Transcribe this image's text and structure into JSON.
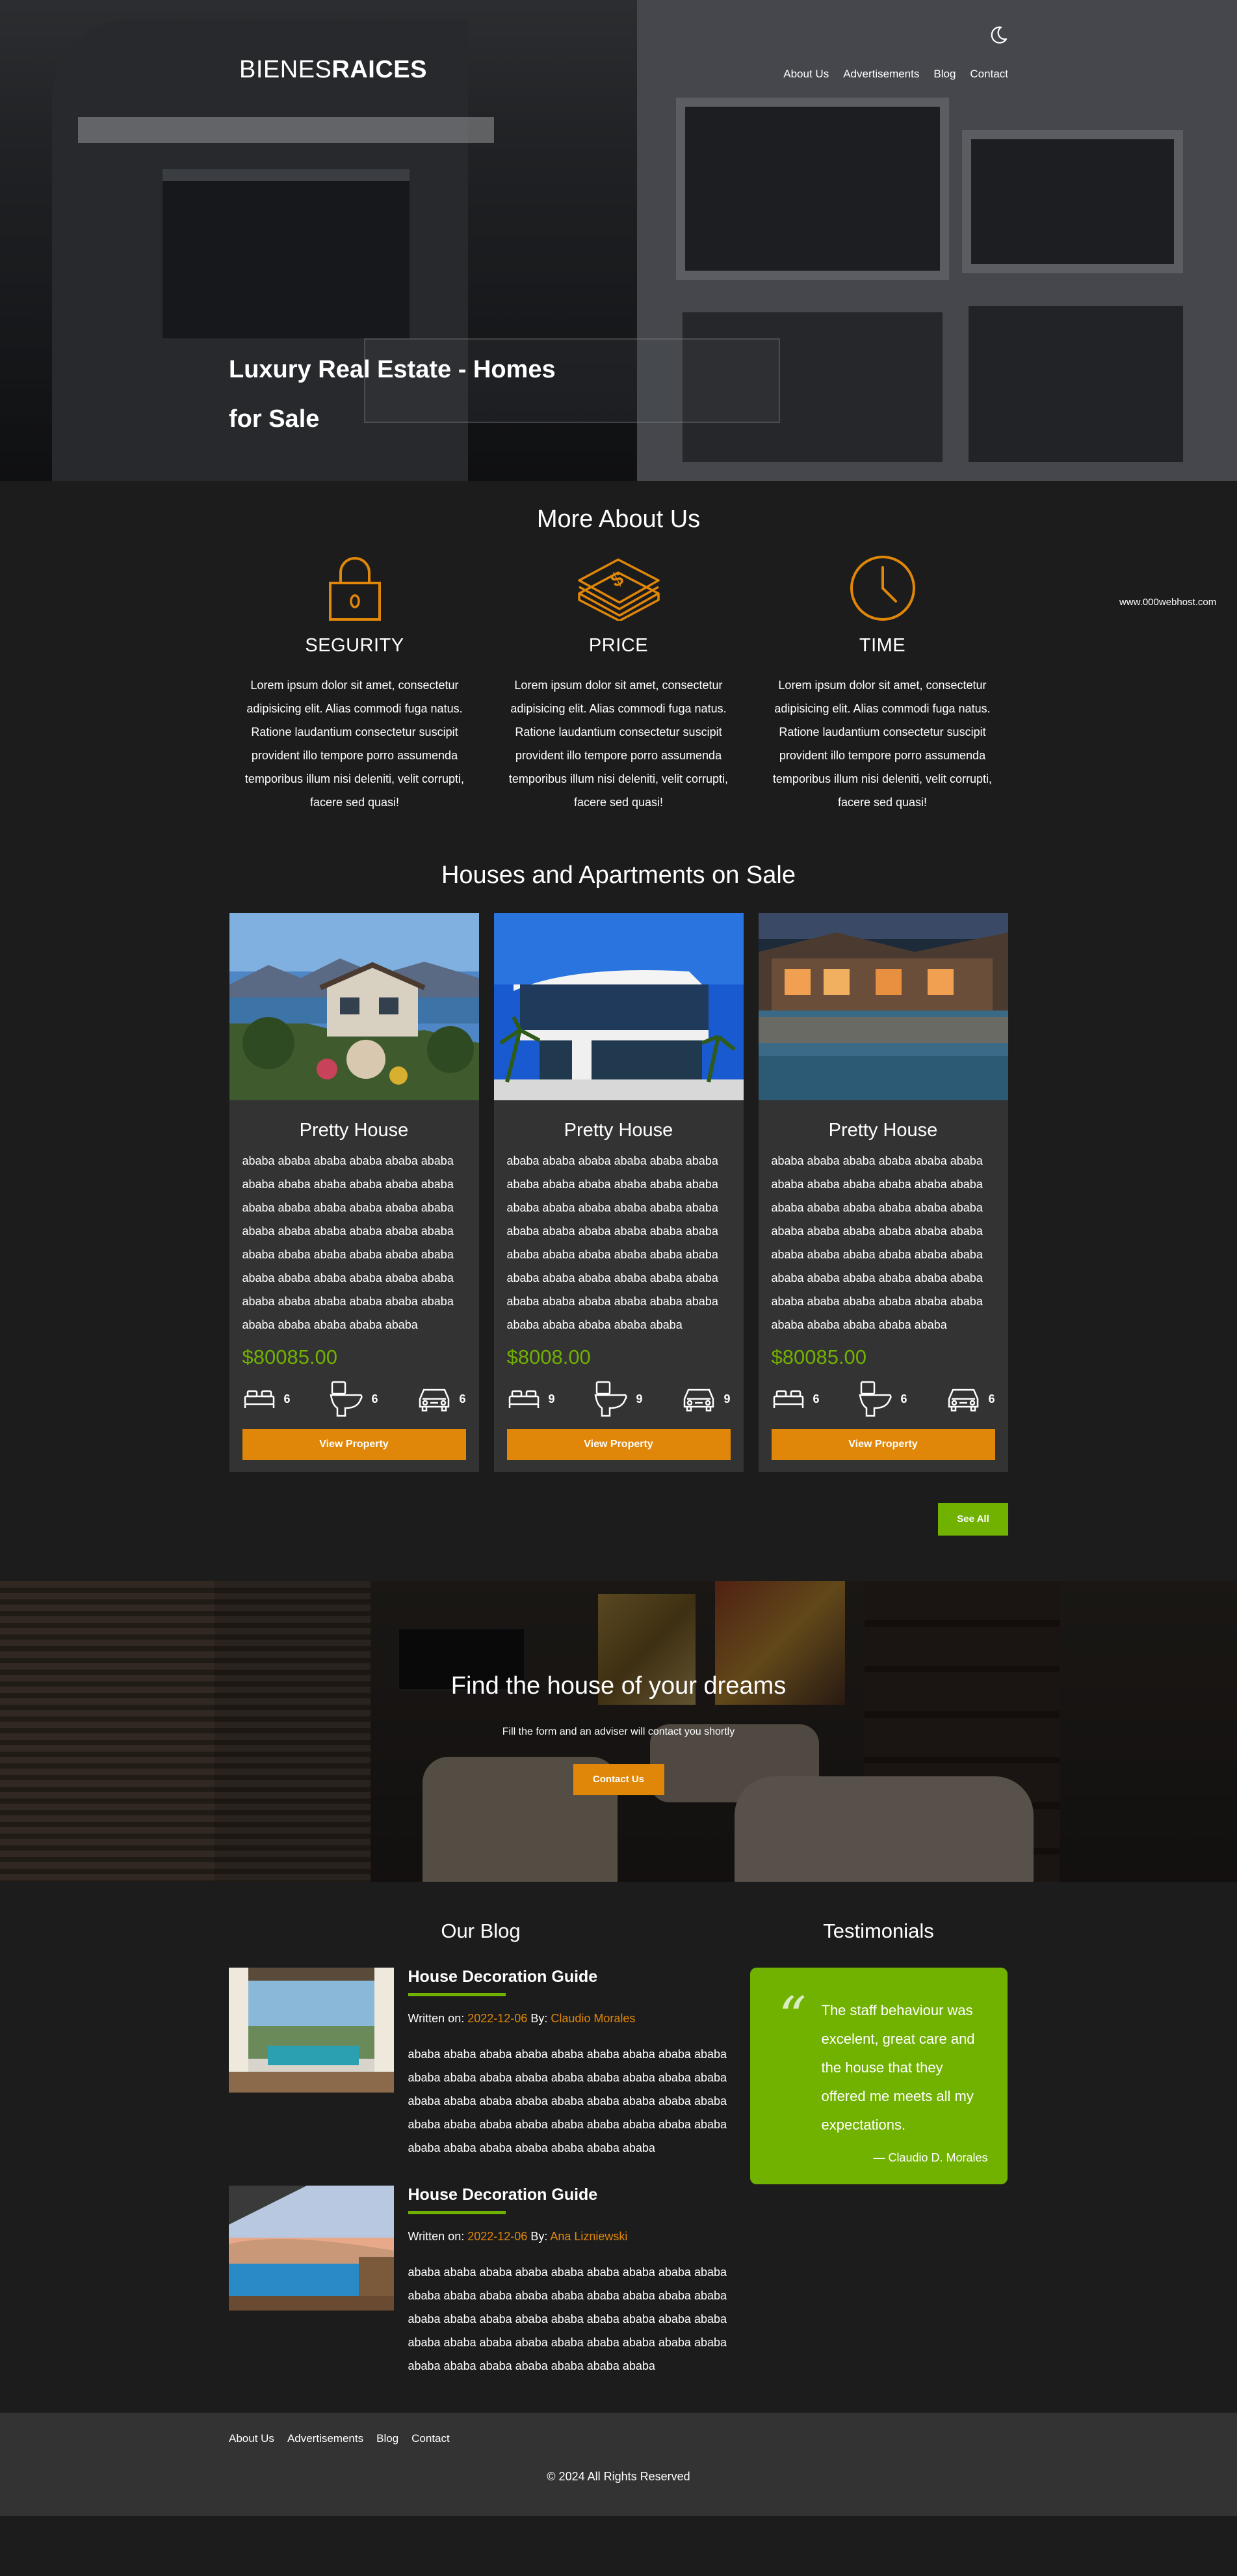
{
  "header": {
    "logo_light": "BIENES",
    "logo_bold": "RAICES",
    "nav": [
      "About Us",
      "Advertisements",
      "Blog",
      "Contact"
    ],
    "hero_title": "Luxury Real Estate - Homes for Sale"
  },
  "watermark": "www.000webhost.com",
  "about": {
    "title": "More About Us",
    "features": [
      {
        "icon": "lock-icon",
        "title": "SEGURITY",
        "text": "Lorem ipsum dolor sit amet, consectetur adipisicing elit. Alias commodi fuga natus. Ratione laudantium consectetur suscipit provident illo tempore porro assumenda temporibus illum nisi deleniti, velit corrupti, facere sed quasi!"
      },
      {
        "icon": "money-stack-icon",
        "title": "PRICE",
        "text": "Lorem ipsum dolor sit amet, consectetur adipisicing elit. Alias commodi fuga natus. Ratione laudantium consectetur suscipit provident illo tempore porro assumenda temporibus illum nisi deleniti, velit corrupti, facere sed quasi!"
      },
      {
        "icon": "clock-icon",
        "title": "TIME",
        "text": "Lorem ipsum dolor sit amet, consectetur adipisicing elit. Alias commodi fuga natus. Ratione laudantium consectetur suscipit provident illo tempore porro assumenda temporibus illum nisi deleniti, velit corrupti, facere sed quasi!"
      }
    ]
  },
  "listings": {
    "title": "Houses and Apartments on Sale",
    "cards": [
      {
        "title": "Pretty House",
        "desc": "ababa ababa ababa ababa ababa ababa ababa ababa ababa ababa ababa ababa ababa ababa ababa ababa ababa ababa ababa ababa ababa ababa ababa ababa ababa ababa ababa ababa ababa ababa ababa ababa ababa ababa ababa ababa ababa ababa ababa ababa ababa ababa ababa ababa ababa ababa ababa",
        "price": "$80085.00",
        "beds": "6",
        "baths": "6",
        "parking": "6",
        "button": "View Property"
      },
      {
        "title": "Pretty House",
        "desc": "ababa ababa ababa ababa ababa ababa ababa ababa ababa ababa ababa ababa ababa ababa ababa ababa ababa ababa ababa ababa ababa ababa ababa ababa ababa ababa ababa ababa ababa ababa ababa ababa ababa ababa ababa ababa ababa ababa ababa ababa ababa ababa ababa ababa ababa ababa ababa",
        "price": "$8008.00",
        "beds": "9",
        "baths": "9",
        "parking": "9",
        "button": "View Property"
      },
      {
        "title": "Pretty House",
        "desc": "ababa ababa ababa ababa ababa ababa ababa ababa ababa ababa ababa ababa ababa ababa ababa ababa ababa ababa ababa ababa ababa ababa ababa ababa ababa ababa ababa ababa ababa ababa ababa ababa ababa ababa ababa ababa ababa ababa ababa ababa ababa ababa ababa ababa ababa ababa ababa",
        "price": "$80085.00",
        "beds": "6",
        "baths": "6",
        "parking": "6",
        "button": "View Property"
      }
    ],
    "see_all": "See All"
  },
  "cta": {
    "title": "Find the house of your dreams",
    "text": "Fill the form and an adviser will contact you shortly",
    "button": "Contact Us"
  },
  "blog": {
    "title": "Our Blog",
    "posts": [
      {
        "title": "House Decoration Guide",
        "written_label": "Written on:",
        "date": "2022-12-06",
        "by_label": "By:",
        "author": "Claudio Morales",
        "text": "ababa ababa ababa ababa ababa ababa ababa ababa ababa ababa ababa ababa ababa ababa ababa ababa ababa ababa ababa ababa ababa ababa ababa ababa ababa ababa ababa ababa ababa ababa ababa ababa ababa ababa ababa ababa ababa ababa ababa ababa ababa ababa ababa"
      },
      {
        "title": "House Decoration Guide",
        "written_label": "Written on:",
        "date": "2022-12-06",
        "by_label": "By:",
        "author": "Ana Lizniewski",
        "text": "ababa ababa ababa ababa ababa ababa ababa ababa ababa ababa ababa ababa ababa ababa ababa ababa ababa ababa ababa ababa ababa ababa ababa ababa ababa ababa ababa ababa ababa ababa ababa ababa ababa ababa ababa ababa ababa ababa ababa ababa ababa ababa ababa"
      }
    ]
  },
  "testimonials": {
    "title": "Testimonials",
    "quote": "The staff behaviour was excelent, great care and the house that they offered me meets all my expectations.",
    "author": "— Claudio D. Morales"
  },
  "footer": {
    "links": [
      "About Us",
      "Advertisements",
      "Blog",
      "Contact"
    ],
    "copyright": "© 2024 All Rights Reserved"
  },
  "colors": {
    "accent_orange": "#e08709",
    "accent_green": "#71b100",
    "background": "#1c1c1c",
    "card": "#333333"
  }
}
